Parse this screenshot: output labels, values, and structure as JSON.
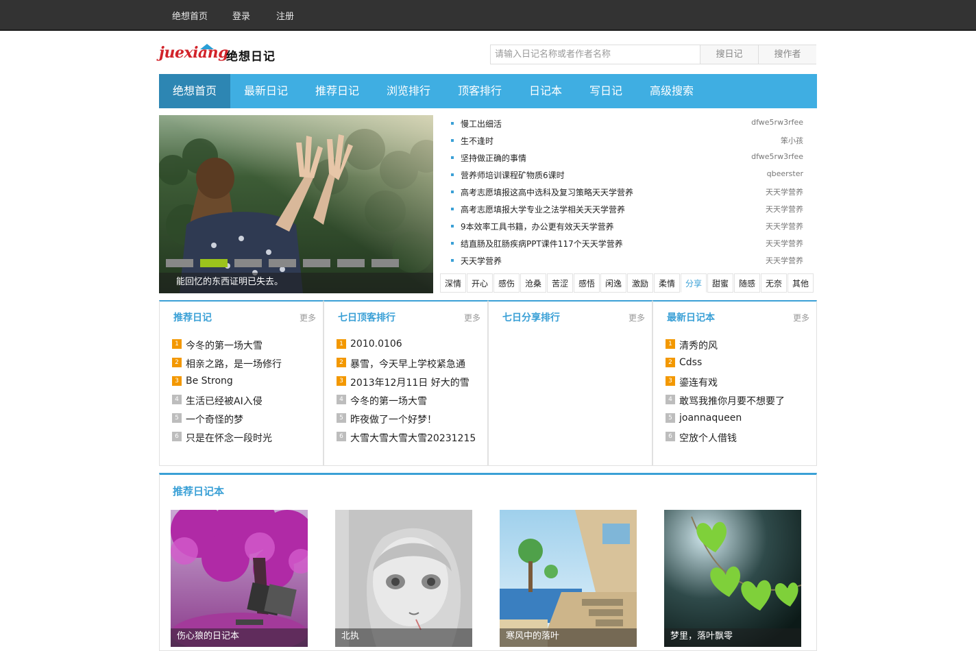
{
  "topbar": {
    "links": [
      "绝想首页",
      "登录",
      "注册"
    ]
  },
  "logo": {
    "latin": "juexiang",
    "chinese": "绝想日记"
  },
  "search": {
    "placeholder": "请输入日记名称或者作者名称",
    "btn_diary": "搜日记",
    "btn_author": "搜作者"
  },
  "nav": {
    "items": [
      "绝想首页",
      "最新日记",
      "推荐日记",
      "浏览排行",
      "顶客排行",
      "日记本",
      "写日记",
      "高级搜索"
    ]
  },
  "slider": {
    "caption": "能回忆的东西证明已失去。",
    "active_dot": 1,
    "dot_count": 7
  },
  "news": [
    {
      "title": "慢工出细活",
      "author": "dfwe5rw3rfee"
    },
    {
      "title": "生不逢时",
      "author": "笨小孩"
    },
    {
      "title": "坚持做正确的事情",
      "author": "dfwe5rw3rfee"
    },
    {
      "title": "营养师培训课程矿物质6课时",
      "author": "qbeerster"
    },
    {
      "title": "高考志愿填报这高中选科及复习策略天天学营养",
      "author": "天天学营养"
    },
    {
      "title": "高考志愿填报大学专业之法学相关天天学营养",
      "author": "天天学营养"
    },
    {
      "title": "9本效率工具书籍，办公更有效天天学营养",
      "author": "天天学营养"
    },
    {
      "title": "结直肠及肛肠疾病PPT课件117个天天学营养",
      "author": "天天学营养"
    },
    {
      "title": "天天学营养",
      "author": "天天学营养"
    }
  ],
  "tags": {
    "items": [
      "深情",
      "开心",
      "感伤",
      "沧桑",
      "苦涩",
      "感悟",
      "闲逸",
      "激励",
      "柔情",
      "分享",
      "甜蜜",
      "随感",
      "无奈",
      "其他"
    ],
    "active": "分享"
  },
  "columns": [
    {
      "title": "推荐日记",
      "more": "更多",
      "items": [
        "今冬的第一场大雪",
        "相亲之路，是一场修行",
        "Be Strong",
        "生活已经被AI入侵",
        "一个奇怪的梦",
        "只是在怀念一段时光"
      ]
    },
    {
      "title": "七日顶客排行",
      "more": "更多",
      "items": [
        "2010.0106",
        "暴雪，今天早上学校紧急通",
        "2013年12月11日 好大的雪",
        "今冬的第一场大雪",
        " 昨夜做了一个好梦！",
        "大雪大雪大雪大雪20231215"
      ]
    },
    {
      "title": "七日分享排行",
      "more": "更多",
      "items": []
    },
    {
      "title": "最新日记本",
      "more": "更多",
      "items": [
        "清秀的风",
        "Cdss",
        "鎏连有戏",
        "敢骂我推你月要不想要了",
        "joannaqueen",
        "空放个人借钱"
      ]
    }
  ],
  "rank_numbers": [
    "1",
    "2",
    "3",
    "4",
    "5",
    "6"
  ],
  "recommended": {
    "title": "推荐日记本",
    "cards": [
      {
        "caption": "伤心狼的日记本",
        "image": "purple-tree-bench"
      },
      {
        "caption": "北执",
        "image": "anime-girl-sketch"
      },
      {
        "caption": "寒风中的落叶",
        "image": "seaside-garden"
      },
      {
        "caption": "梦里，落叶飘零",
        "image": "green-heart-leaves"
      }
    ]
  },
  "colors": {
    "accent": "#3aa0d6",
    "nav": "#3faee2",
    "nav_active": "#2d86b3",
    "topbar": "#333333",
    "rank_top": "#f39800",
    "rank_other": "#bdbdbd",
    "dot_active": "#9cc31c"
  }
}
